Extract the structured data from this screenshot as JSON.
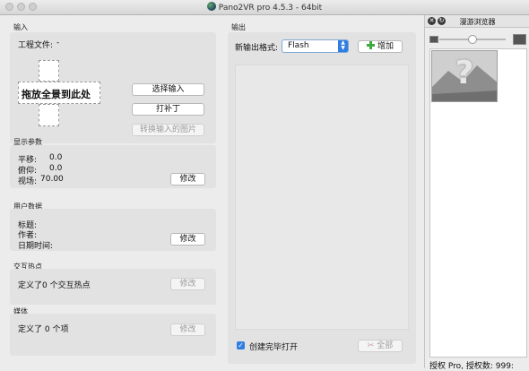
{
  "window": {
    "title": "Pano2VR pro 4.5.3 - 64bit"
  },
  "input": {
    "section_title": "输入",
    "project_file_label": "工程文件:",
    "project_file_value": "-",
    "drop_text": "拖放全景到此处",
    "select_input_button": "选择输入",
    "patch_button": "打补丁",
    "convert_button": "转换输入的图片"
  },
  "display": {
    "section_title": "显示参数",
    "pan_label": "平移:",
    "pan_value": "0.0",
    "tilt_label": "俯仰:",
    "tilt_value": "0.0",
    "fov_label": "视场:",
    "fov_value": "70.00",
    "modify_button": "修改"
  },
  "userdata": {
    "section_title": "用户数据",
    "title_label": "标题:",
    "author_label": "作者:",
    "datetime_label": "日期时间:",
    "modify_button": "修改"
  },
  "hotspots": {
    "section_title": "交互热点",
    "summary": "定义了0 个交互热点",
    "modify_button": "修改"
  },
  "media": {
    "section_title": "媒体",
    "summary": "定义了 0 个项",
    "modify_button": "修改"
  },
  "output": {
    "section_title": "输出",
    "format_label": "新输出格式:",
    "format_value": "Flash",
    "add_button": "增加",
    "open_after_label": "创建完毕打开",
    "open_after_checked": true,
    "all_button": "全部"
  },
  "browser": {
    "title": "漫游浏览器",
    "zoom_level": 0.5,
    "thumbnail_glyph": "?",
    "footer": "授权 Pro, 授权数: 999:"
  }
}
